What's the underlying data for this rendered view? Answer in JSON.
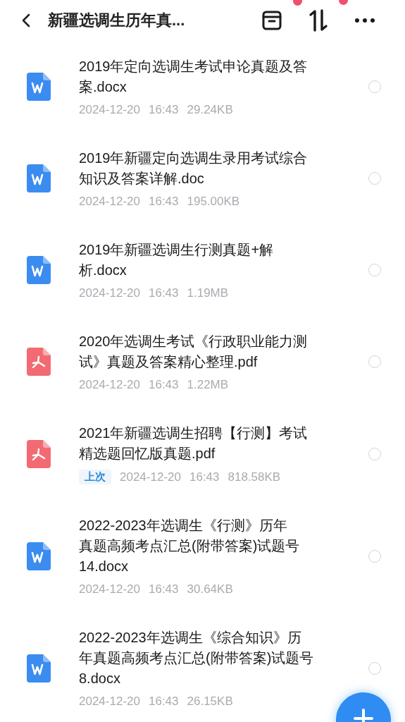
{
  "header": {
    "title": "新疆选调生历年真..."
  },
  "files": [
    {
      "kind": "word",
      "title_lines": [
        "2019年定向选调生考试申论真题及答",
        "案.docx"
      ],
      "date": "2024-12-20",
      "time": "16:43",
      "size": "29.24KB",
      "selected": false
    },
    {
      "kind": "word",
      "title_lines": [
        "2019年新疆定向选调生录用考试综合",
        "知识及答案详解.doc"
      ],
      "date": "2024-12-20",
      "time": "16:43",
      "size": "195.00KB",
      "selected": false
    },
    {
      "kind": "word",
      "title_lines": [
        "2019年新疆选调生行测真题+解",
        "析.docx"
      ],
      "date": "2024-12-20",
      "time": "16:43",
      "size": "1.19MB",
      "selected": false
    },
    {
      "kind": "pdf",
      "title_lines": [
        "2020年选调生考试《行政职业能力测",
        "试》真题及答案精心整理.pdf"
      ],
      "date": "2024-12-20",
      "time": "16:43",
      "size": "1.22MB",
      "selected": false
    },
    {
      "kind": "pdf",
      "title_lines": [
        "2021年新疆选调生招聘【行测】考试",
        "精选题回忆版真题.pdf"
      ],
      "badge": "上次",
      "date": "2024-12-20",
      "time": "16:43",
      "size": "818.58KB",
      "selected": false
    },
    {
      "kind": "word",
      "title_lines": [
        "2022-2023年选调生《行测》历年",
        "真题高频考点汇总(附带答案)试题号",
        "14.docx"
      ],
      "date": "2024-12-20",
      "time": "16:43",
      "size": "30.64KB",
      "selected": false
    },
    {
      "kind": "word",
      "title_lines": [
        "2022-2023年选调生《综合知识》历",
        "年真题高频考点汇总(附带答案)试题号",
        "8.docx"
      ],
      "date": "2024-12-20",
      "time": "16:43",
      "size": "26.15KB",
      "selected": false
    }
  ]
}
